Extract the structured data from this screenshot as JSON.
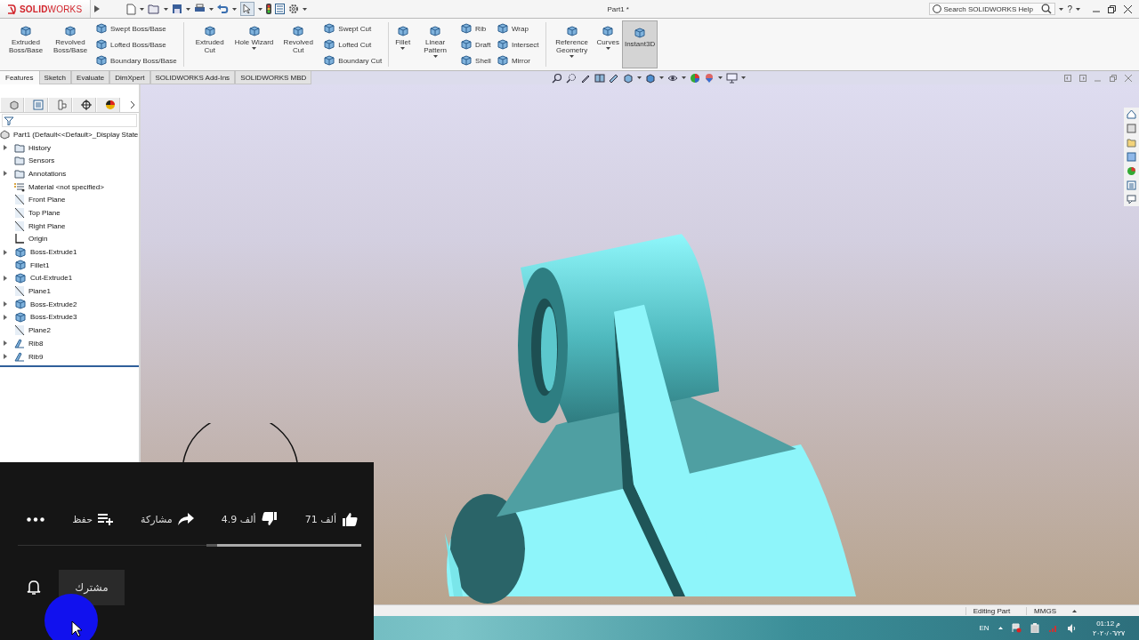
{
  "app": {
    "logo": "**SOLID**WORKS",
    "title": "Part1 *",
    "help_search": {
      "placeholder": "Search SOLIDWORKS Help"
    },
    "help_menu": "?"
  },
  "ribbon": [
    {
      "kind": "large",
      "label": "Extruded Boss/Base",
      "dropdown": false,
      "on": false
    },
    {
      "kind": "large",
      "label": "Revolved Boss/Base",
      "dropdown": false,
      "on": false
    },
    {
      "kind": "stack",
      "items": [
        "Swept Boss/Base",
        "Lofted Boss/Base",
        "Boundary Boss/Base"
      ]
    },
    {
      "kind": "separator"
    },
    {
      "kind": "large",
      "label": "Extruded Cut",
      "dropdown": false,
      "on": false
    },
    {
      "kind": "large",
      "label": "Hole Wizard",
      "dropdown": true,
      "on": false
    },
    {
      "kind": "large",
      "label": "Revolved Cut",
      "dropdown": false,
      "on": false
    },
    {
      "kind": "stack",
      "items": [
        "Swept Cut",
        "Lofted Cut",
        "Boundary Cut"
      ]
    },
    {
      "kind": "separator"
    },
    {
      "kind": "large",
      "label": "Fillet",
      "dropdown": true,
      "on": false
    },
    {
      "kind": "large",
      "label": "Linear Pattern",
      "dropdown": true,
      "on": false
    },
    {
      "kind": "stack",
      "items": [
        "Rib",
        "Draft",
        "Shell"
      ]
    },
    {
      "kind": "stack",
      "items": [
        "Wrap",
        "Intersect",
        "Mirror"
      ]
    },
    {
      "kind": "separator"
    },
    {
      "kind": "large",
      "label": "Reference Geometry",
      "dropdown": true,
      "on": false
    },
    {
      "kind": "large",
      "label": "Curves",
      "dropdown": true,
      "on": false
    },
    {
      "kind": "large",
      "label": "Instant3D",
      "dropdown": false,
      "on": true
    }
  ],
  "tabs": [
    {
      "label": "Features",
      "selected": true
    },
    {
      "label": "Sketch",
      "selected": false
    },
    {
      "label": "Evaluate",
      "selected": false
    },
    {
      "label": "DimXpert",
      "selected": false
    },
    {
      "label": "SOLIDWORKS Add-Ins",
      "selected": false
    },
    {
      "label": "SOLIDWORKS MBD",
      "selected": false
    }
  ],
  "feature_tree": {
    "root": {
      "label": "Part1  (Default<<Default>_Display State",
      "children": [
        {
          "label": "History",
          "kind": "folder",
          "expandable": true
        },
        {
          "label": "Sensors",
          "kind": "folder",
          "expandable": false
        },
        {
          "label": "Annotations",
          "kind": "folder",
          "expandable": true
        },
        {
          "label": "Material <not specified>",
          "kind": "material",
          "expandable": false
        },
        {
          "label": "Front Plane",
          "kind": "plane",
          "expandable": false
        },
        {
          "label": "Top Plane",
          "kind": "plane",
          "expandable": false
        },
        {
          "label": "Right Plane",
          "kind": "plane",
          "expandable": false
        },
        {
          "label": "Origin",
          "kind": "origin",
          "expandable": false
        },
        {
          "label": "Boss-Extrude1",
          "kind": "feature",
          "expandable": true
        },
        {
          "label": "Fillet1",
          "kind": "feature",
          "expandable": false
        },
        {
          "label": "Cut-Extrude1",
          "kind": "feature",
          "expandable": true
        },
        {
          "label": "Plane1",
          "kind": "plane",
          "expandable": false
        },
        {
          "label": "Boss-Extrude2",
          "kind": "feature",
          "expandable": true
        },
        {
          "label": "Boss-Extrude3",
          "kind": "feature",
          "expandable": true
        },
        {
          "label": "Plane2",
          "kind": "plane",
          "expandable": false
        },
        {
          "label": "Rib8",
          "kind": "rib",
          "expandable": true
        },
        {
          "label": "Rib9",
          "kind": "rib",
          "expandable": true
        }
      ]
    }
  },
  "video_overlay": {
    "like": "71 ألف",
    "dislike": "4.9 ألف",
    "share": "مشاركة",
    "save": "حفظ",
    "sentiment": {
      "level": 0.93
    },
    "subscribe": "مشترك"
  },
  "status_bar": {
    "mode": "Editing Part",
    "units": "MMGS"
  },
  "taskbar": {
    "language": "EN",
    "time": "01:12 م",
    "date": "٢٠٢٠/٠٦/٢٧"
  }
}
